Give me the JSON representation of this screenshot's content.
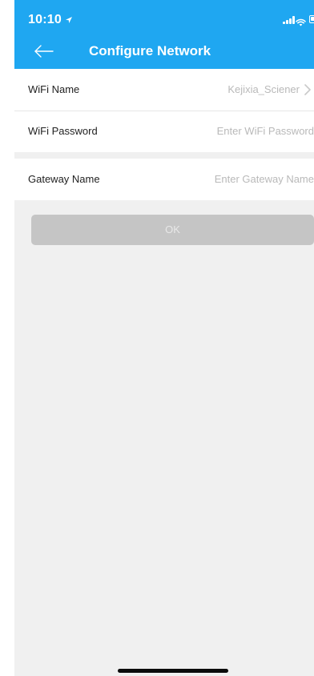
{
  "status_bar": {
    "time": "10:10",
    "location_icon": "location-arrow-icon",
    "signal_icon": "cellular-signal-icon",
    "wifi_icon": "wifi-icon",
    "battery_icon": "battery-icon"
  },
  "header": {
    "back_icon": "back-arrow-icon",
    "title": "Configure Network",
    "background_color": "#1fa7f1"
  },
  "form": {
    "wifi_name": {
      "label": "WiFi Name",
      "value": "Kejixia_Sciener"
    },
    "wifi_password": {
      "label": "WiFi Password",
      "placeholder": "Enter WiFi Password"
    },
    "gateway_name": {
      "label": "Gateway Name",
      "placeholder": "Enter Gateway Name"
    }
  },
  "actions": {
    "ok_label": "OK",
    "ok_enabled": false
  }
}
